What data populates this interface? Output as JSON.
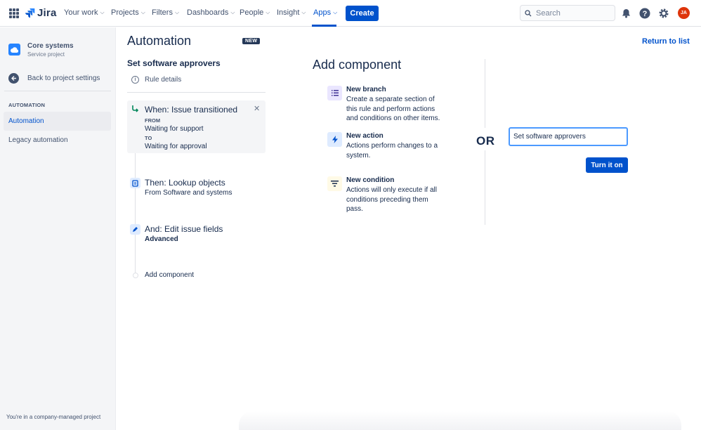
{
  "brand": {
    "name": "Jira",
    "accent": "#0052cc"
  },
  "topnav": {
    "items": [
      {
        "label": "Your work"
      },
      {
        "label": "Projects"
      },
      {
        "label": "Filters"
      },
      {
        "label": "Dashboards"
      },
      {
        "label": "People"
      },
      {
        "label": "Insight"
      },
      {
        "label": "Apps"
      }
    ],
    "active": "Apps",
    "create_label": "Create",
    "search_placeholder": "Search",
    "avatar_initials": "JA",
    "icons": [
      "app-switcher-icon",
      "notification-bell-icon",
      "help-icon",
      "settings-gear-icon"
    ]
  },
  "sidebar": {
    "project_name": "Core systems",
    "project_type": "Service project",
    "back_label": "Back to project settings",
    "section_heading": "AUTOMATION",
    "items": [
      {
        "label": "Automation",
        "active": true
      },
      {
        "label": "Legacy automation",
        "active": false
      }
    ],
    "footer": "You're in a company-managed project"
  },
  "main": {
    "title": "Automation",
    "badge": "NEW",
    "rule_name": "Set software approvers",
    "rule_details_label": "Rule details",
    "trigger": {
      "title": "When: Issue transitioned",
      "from_label": "FROM",
      "from_value": "Waiting for support",
      "to_label": "TO",
      "to_value": "Waiting for approval"
    },
    "steps": [
      {
        "title": "Then: Lookup objects",
        "subtitle": "From Software and systems"
      },
      {
        "title": "And: Edit issue fields",
        "subtitle": "Advanced"
      }
    ],
    "add_component_label": "Add component"
  },
  "add_component": {
    "title": "Add component",
    "components": [
      {
        "title": "New branch",
        "description": "Create a separate section of this rule and perform actions and conditions on other items."
      },
      {
        "title": "New action",
        "description": "Actions perform changes to a system."
      },
      {
        "title": "New condition",
        "description": "Actions will only execute if all conditions preceding them pass."
      }
    ],
    "or_label": "OR"
  },
  "right": {
    "return_label": "Return to list",
    "rule_name_value": "Set software approvers",
    "turn_on_label": "Turn it on"
  }
}
